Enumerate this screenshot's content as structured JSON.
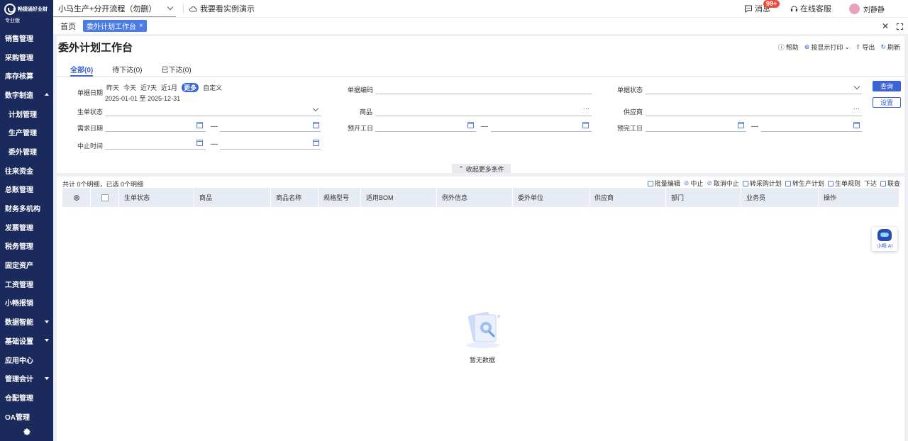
{
  "brand": {
    "name": "畅捷通好业财",
    "edition": "专业版"
  },
  "sidebar": {
    "items": [
      {
        "label": "销售管理",
        "caret": ""
      },
      {
        "label": "采购管理",
        "caret": ""
      },
      {
        "label": "库存核算",
        "caret": ""
      },
      {
        "label": "数字制造",
        "caret": "up"
      },
      {
        "label": "计划管理",
        "caret": "",
        "sub": true
      },
      {
        "label": "生产管理",
        "caret": "",
        "sub": true
      },
      {
        "label": "委外管理",
        "caret": "",
        "sub": true
      },
      {
        "label": "往来资金",
        "caret": ""
      },
      {
        "label": "总账管理",
        "caret": ""
      },
      {
        "label": "财务多机构",
        "caret": ""
      },
      {
        "label": "发票管理",
        "caret": ""
      },
      {
        "label": "税务管理",
        "caret": ""
      },
      {
        "label": "固定资产",
        "caret": ""
      },
      {
        "label": "工资管理",
        "caret": ""
      },
      {
        "label": "小畅报销",
        "caret": ""
      },
      {
        "label": "数据智能",
        "caret": "down"
      },
      {
        "label": "基础设置",
        "caret": "down"
      },
      {
        "label": "应用中心",
        "caret": ""
      },
      {
        "label": "管理会计",
        "caret": "down"
      },
      {
        "label": "仓配管理",
        "caret": ""
      },
      {
        "label": "OA管理",
        "caret": ""
      }
    ]
  },
  "topbar": {
    "company": "小马生产+分开流程（勿删）",
    "demo": "我要看实例演示",
    "messages": "消息",
    "message_badge": "99+",
    "service": "在线客服",
    "user": "刘静静"
  },
  "tabs": {
    "home": "首页",
    "active": "委外计划工作台",
    "close": "×"
  },
  "page": {
    "title": "委外计划工作台",
    "tools": {
      "help": "帮助",
      "print": "按显示打印",
      "export": "导出",
      "refresh": "刷新"
    },
    "status_tabs": [
      "全部(0)",
      "待下达(0)",
      "已下达(0)"
    ]
  },
  "filters": {
    "doc_date": "单据日期",
    "quick": [
      "昨天",
      "今天",
      "近7天",
      "近1月",
      "更多",
      "自定义"
    ],
    "date_range": "2025-01-01 至 2025-12-31",
    "doc_no": "单据编码",
    "doc_status": "单据状态",
    "gen_status": "生单状态",
    "product": "商品",
    "supplier": "供应商",
    "demand_date": "需求日期",
    "pre_start": "预开工日",
    "pre_finish": "预完工日",
    "stop_time": "中止时间",
    "dash": "—",
    "query": "查询",
    "settings": "设置",
    "collapse": "收起更多条件"
  },
  "table": {
    "summary": "共计 0个明细，已选 0个明细",
    "actions": [
      "批量编辑",
      "中止",
      "取消中止",
      "转采购计划",
      "转生产计划",
      "生单规则",
      "下达",
      "联查"
    ],
    "columns": [
      "生单状态",
      "商品",
      "商品名称",
      "规格型号",
      "适用BOM",
      "例外信息",
      "委外单位",
      "供应商",
      "部门",
      "业务员",
      "操作"
    ],
    "empty": "暂无数据"
  },
  "assistant": "小畅 AI"
}
